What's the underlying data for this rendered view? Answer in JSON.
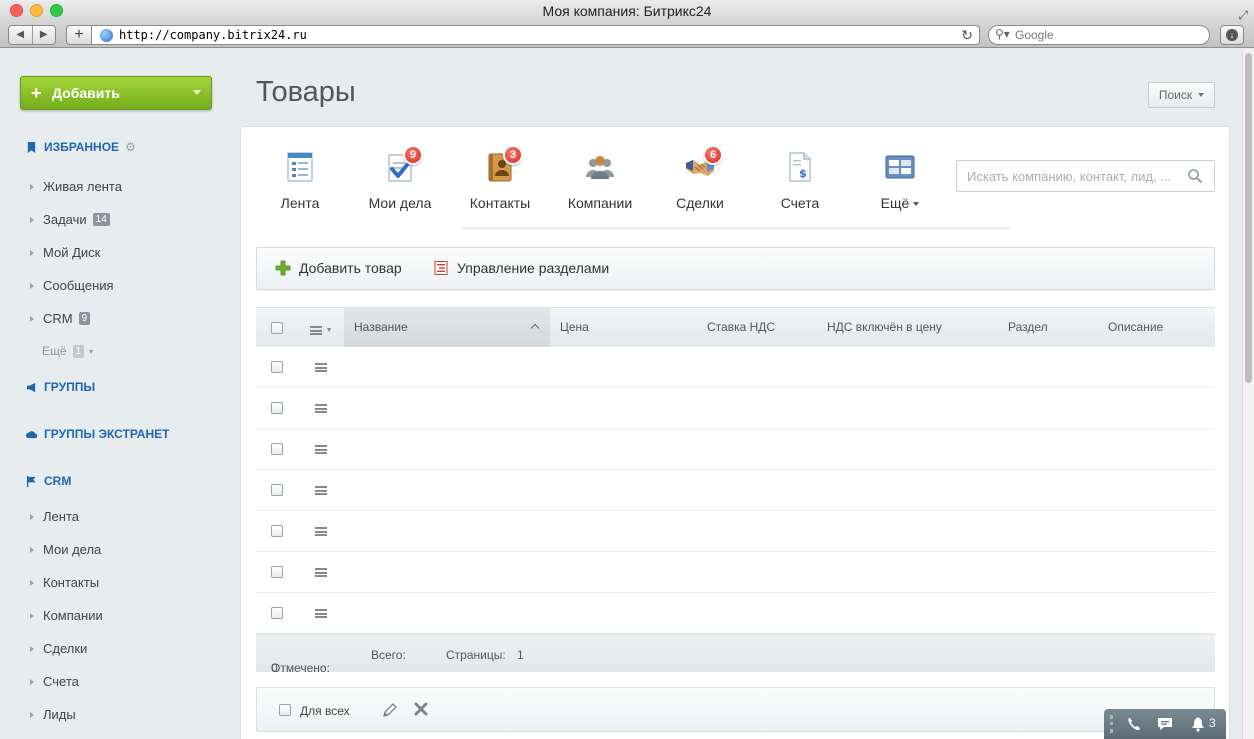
{
  "window": {
    "title": "Моя компания: Битрикс24"
  },
  "browser": {
    "url": "http://company.bitrix24.ru",
    "search_placeholder": "Google"
  },
  "left_menu": {
    "add_button": "Добавить",
    "favorites": {
      "title": "ИЗБРАННОЕ",
      "items": [
        {
          "label": "Живая лента",
          "count": ""
        },
        {
          "label": "Задачи",
          "count": "14"
        },
        {
          "label": "Мой Диск",
          "count": ""
        },
        {
          "label": "Сообщения",
          "count": ""
        },
        {
          "label": "CRM",
          "count": "9"
        }
      ],
      "more_label": "Ещё",
      "more_count": "1"
    },
    "groups_title": "ГРУППЫ",
    "extranet_title": "ГРУППЫ ЭКСТРАНЕТ",
    "crm": {
      "title": "CRM",
      "items": [
        "Лента",
        "Мои дела",
        "Контакты",
        "Компании",
        "Сделки",
        "Счета",
        "Лиды"
      ]
    }
  },
  "header": {
    "title": "Товары",
    "search_button": "Поиск"
  },
  "crm_tabs": [
    {
      "label": "Лента",
      "icon": "feed-icon",
      "badge": ""
    },
    {
      "label": "Мои дела",
      "icon": "tasks-check-icon",
      "badge": "9"
    },
    {
      "label": "Контакты",
      "icon": "contacts-book-icon",
      "badge": "3"
    },
    {
      "label": "Компании",
      "icon": "companies-people-icon",
      "badge": ""
    },
    {
      "label": "Сделки",
      "icon": "handshake-icon",
      "badge": "6"
    },
    {
      "label": "Счета",
      "icon": "invoice-icon",
      "badge": ""
    },
    {
      "label": "Ещё",
      "icon": "more-icon",
      "badge": ""
    }
  ],
  "crm_search": {
    "placeholder": "Искать компанию, контакт, лид, ..."
  },
  "actions": {
    "add_product": "Добавить товар",
    "manage_sections": "Управление разделами"
  },
  "grid": {
    "columns": [
      "Название",
      "Цена",
      "Ставка НДС",
      "НДС включён в цену",
      "Раздел",
      "Описание"
    ],
    "row_count": 7
  },
  "footer": {
    "selected_label": "Отмечено:",
    "selected_value": "0",
    "total_label": "Всего:",
    "pages_label": "Страницы:",
    "pages_value": "1"
  },
  "group_actions": {
    "for_all": "Для всех"
  },
  "im_bar": {
    "notifications_count": "3"
  },
  "colors": {
    "accent": "#2067b0",
    "add_green": "#8cc42b",
    "badge_red": "#d22b1c"
  }
}
